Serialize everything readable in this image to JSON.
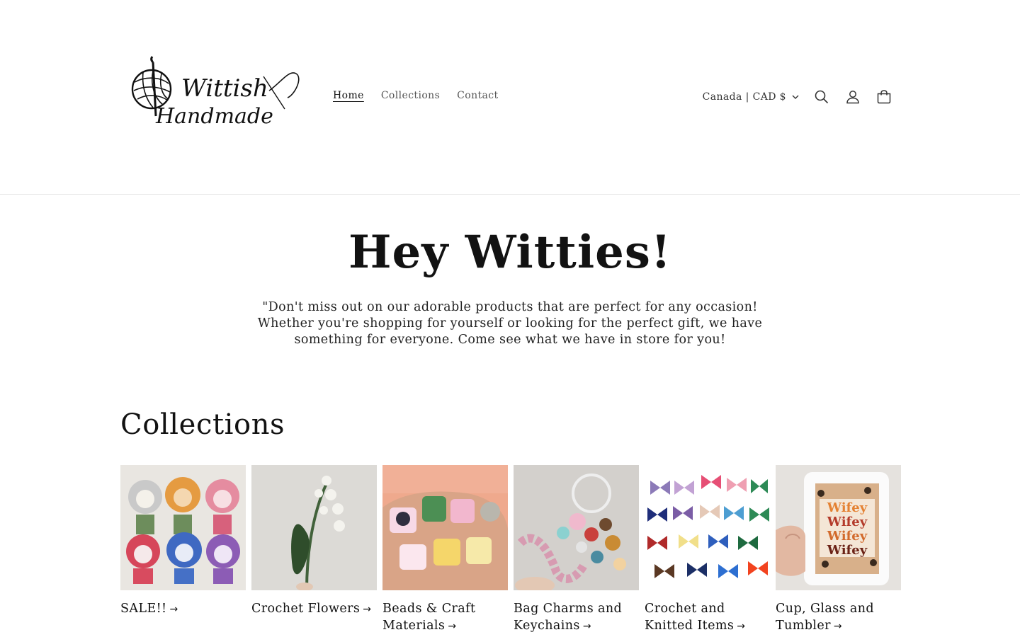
{
  "brand": {
    "logo_line1": "Wittish",
    "logo_line2": "Handmade"
  },
  "nav": {
    "items": [
      {
        "label": "Home"
      },
      {
        "label": "Collections"
      },
      {
        "label": "Contact"
      }
    ]
  },
  "header": {
    "localization": "Canada | CAD $",
    "icons": [
      "search-icon",
      "account-icon",
      "cart-icon"
    ]
  },
  "hero": {
    "title": "Hey Witties!",
    "text": "\"Don't miss out on our adorable products that are perfect for any occasion! Whether you're shopping for yourself or looking for the perfect gift, we have something for everyone. Come see what we have in store for you!"
  },
  "collections": {
    "heading": "Collections",
    "items": [
      {
        "title": "SALE!!"
      },
      {
        "title": "Crochet Flowers"
      },
      {
        "title": "Beads & Craft Materials"
      },
      {
        "title": "Bag Charms and Keychains"
      },
      {
        "title": "Crochet and Knitted Items"
      },
      {
        "title": "Cup, Glass and Tumbler"
      }
    ],
    "mug_text": "Wifey"
  }
}
